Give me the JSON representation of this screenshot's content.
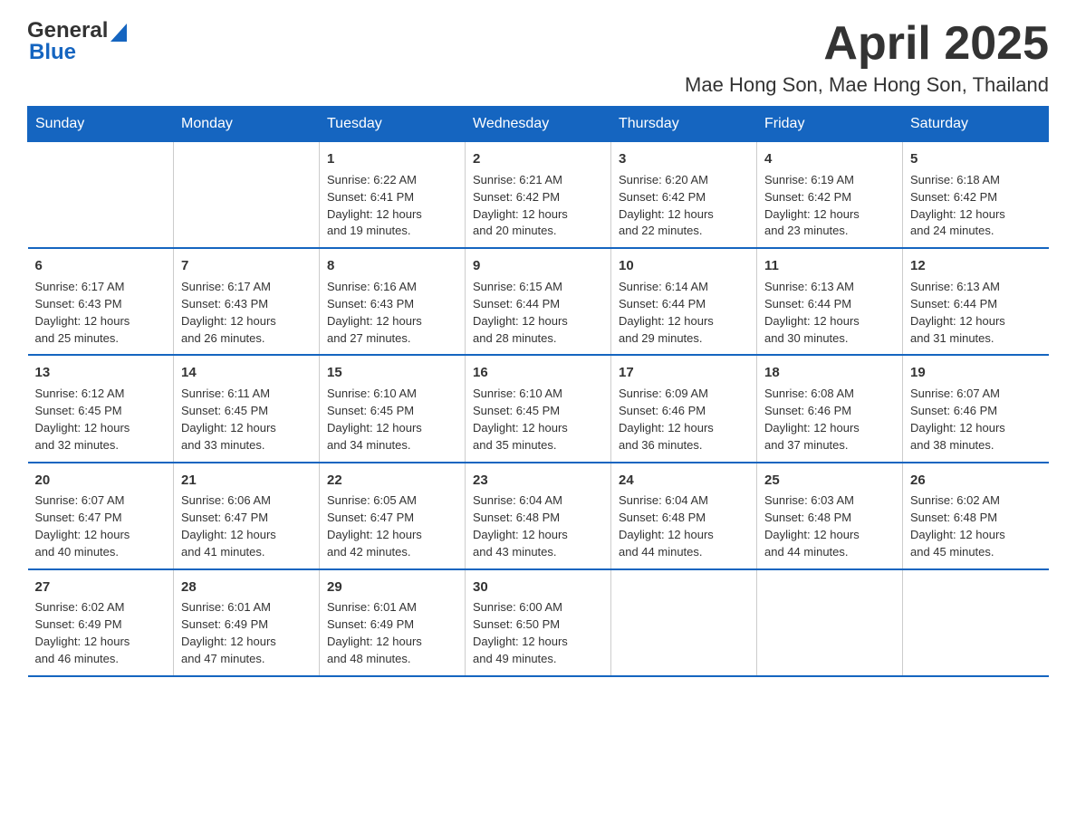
{
  "logo": {
    "general": "General",
    "blue": "Blue"
  },
  "title": "April 2025",
  "subtitle": "Mae Hong Son, Mae Hong Son, Thailand",
  "header_color": "#1565C0",
  "days_of_week": [
    "Sunday",
    "Monday",
    "Tuesday",
    "Wednesday",
    "Thursday",
    "Friday",
    "Saturday"
  ],
  "weeks": [
    [
      {
        "day": "",
        "info": ""
      },
      {
        "day": "",
        "info": ""
      },
      {
        "day": "1",
        "info": "Sunrise: 6:22 AM\nSunset: 6:41 PM\nDaylight: 12 hours\nand 19 minutes."
      },
      {
        "day": "2",
        "info": "Sunrise: 6:21 AM\nSunset: 6:42 PM\nDaylight: 12 hours\nand 20 minutes."
      },
      {
        "day": "3",
        "info": "Sunrise: 6:20 AM\nSunset: 6:42 PM\nDaylight: 12 hours\nand 22 minutes."
      },
      {
        "day": "4",
        "info": "Sunrise: 6:19 AM\nSunset: 6:42 PM\nDaylight: 12 hours\nand 23 minutes."
      },
      {
        "day": "5",
        "info": "Sunrise: 6:18 AM\nSunset: 6:42 PM\nDaylight: 12 hours\nand 24 minutes."
      }
    ],
    [
      {
        "day": "6",
        "info": "Sunrise: 6:17 AM\nSunset: 6:43 PM\nDaylight: 12 hours\nand 25 minutes."
      },
      {
        "day": "7",
        "info": "Sunrise: 6:17 AM\nSunset: 6:43 PM\nDaylight: 12 hours\nand 26 minutes."
      },
      {
        "day": "8",
        "info": "Sunrise: 6:16 AM\nSunset: 6:43 PM\nDaylight: 12 hours\nand 27 minutes."
      },
      {
        "day": "9",
        "info": "Sunrise: 6:15 AM\nSunset: 6:44 PM\nDaylight: 12 hours\nand 28 minutes."
      },
      {
        "day": "10",
        "info": "Sunrise: 6:14 AM\nSunset: 6:44 PM\nDaylight: 12 hours\nand 29 minutes."
      },
      {
        "day": "11",
        "info": "Sunrise: 6:13 AM\nSunset: 6:44 PM\nDaylight: 12 hours\nand 30 minutes."
      },
      {
        "day": "12",
        "info": "Sunrise: 6:13 AM\nSunset: 6:44 PM\nDaylight: 12 hours\nand 31 minutes."
      }
    ],
    [
      {
        "day": "13",
        "info": "Sunrise: 6:12 AM\nSunset: 6:45 PM\nDaylight: 12 hours\nand 32 minutes."
      },
      {
        "day": "14",
        "info": "Sunrise: 6:11 AM\nSunset: 6:45 PM\nDaylight: 12 hours\nand 33 minutes."
      },
      {
        "day": "15",
        "info": "Sunrise: 6:10 AM\nSunset: 6:45 PM\nDaylight: 12 hours\nand 34 minutes."
      },
      {
        "day": "16",
        "info": "Sunrise: 6:10 AM\nSunset: 6:45 PM\nDaylight: 12 hours\nand 35 minutes."
      },
      {
        "day": "17",
        "info": "Sunrise: 6:09 AM\nSunset: 6:46 PM\nDaylight: 12 hours\nand 36 minutes."
      },
      {
        "day": "18",
        "info": "Sunrise: 6:08 AM\nSunset: 6:46 PM\nDaylight: 12 hours\nand 37 minutes."
      },
      {
        "day": "19",
        "info": "Sunrise: 6:07 AM\nSunset: 6:46 PM\nDaylight: 12 hours\nand 38 minutes."
      }
    ],
    [
      {
        "day": "20",
        "info": "Sunrise: 6:07 AM\nSunset: 6:47 PM\nDaylight: 12 hours\nand 40 minutes."
      },
      {
        "day": "21",
        "info": "Sunrise: 6:06 AM\nSunset: 6:47 PM\nDaylight: 12 hours\nand 41 minutes."
      },
      {
        "day": "22",
        "info": "Sunrise: 6:05 AM\nSunset: 6:47 PM\nDaylight: 12 hours\nand 42 minutes."
      },
      {
        "day": "23",
        "info": "Sunrise: 6:04 AM\nSunset: 6:48 PM\nDaylight: 12 hours\nand 43 minutes."
      },
      {
        "day": "24",
        "info": "Sunrise: 6:04 AM\nSunset: 6:48 PM\nDaylight: 12 hours\nand 44 minutes."
      },
      {
        "day": "25",
        "info": "Sunrise: 6:03 AM\nSunset: 6:48 PM\nDaylight: 12 hours\nand 44 minutes."
      },
      {
        "day": "26",
        "info": "Sunrise: 6:02 AM\nSunset: 6:48 PM\nDaylight: 12 hours\nand 45 minutes."
      }
    ],
    [
      {
        "day": "27",
        "info": "Sunrise: 6:02 AM\nSunset: 6:49 PM\nDaylight: 12 hours\nand 46 minutes."
      },
      {
        "day": "28",
        "info": "Sunrise: 6:01 AM\nSunset: 6:49 PM\nDaylight: 12 hours\nand 47 minutes."
      },
      {
        "day": "29",
        "info": "Sunrise: 6:01 AM\nSunset: 6:49 PM\nDaylight: 12 hours\nand 48 minutes."
      },
      {
        "day": "30",
        "info": "Sunrise: 6:00 AM\nSunset: 6:50 PM\nDaylight: 12 hours\nand 49 minutes."
      },
      {
        "day": "",
        "info": ""
      },
      {
        "day": "",
        "info": ""
      },
      {
        "day": "",
        "info": ""
      }
    ]
  ]
}
